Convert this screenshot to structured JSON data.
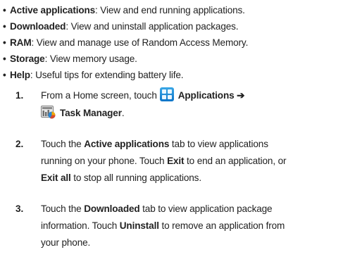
{
  "bullets": [
    {
      "term": "Active applications",
      "desc": ": View and end running applications."
    },
    {
      "term": "Downloaded",
      "desc": ": View and uninstall application packages."
    },
    {
      "term": "RAM",
      "desc": ": View and manage use of Random Access Memory."
    },
    {
      "term": "Storage",
      "desc": ": View memory usage."
    },
    {
      "term": "Help",
      "desc": ": Useful tips for extending battery life."
    }
  ],
  "bullet_glyph": "•",
  "steps": [
    {
      "num": "1.",
      "line1_prefix": "From a Home screen, touch",
      "line1_bold": "Applications ➔",
      "line2_bold": "Task Manager",
      "line2_suffix": "."
    },
    {
      "num": "2.",
      "l1": "Touch the ",
      "l1_b": "Active applications",
      "l1_s": " tab to view applications",
      "l2": "running on your phone. Touch ",
      "l2_b": "Exit",
      "l2_s": " to end an application, or",
      "l3_b": "Exit all",
      "l3_s": " to stop all running applications."
    },
    {
      "num": "3.",
      "l1": "Touch the ",
      "l1_b": "Downloaded",
      "l1_s": " tab to view application package",
      "l2": "information. Touch ",
      "l2_b": "Uninstall",
      "l2_s": " to remove an application from",
      "l3": "your phone."
    }
  ],
  "icons": {
    "applications": "applications-grid-icon",
    "task_manager": "task-manager-icon"
  },
  "colors": {
    "text": "#222222",
    "app_icon": "#1a8ad8"
  }
}
